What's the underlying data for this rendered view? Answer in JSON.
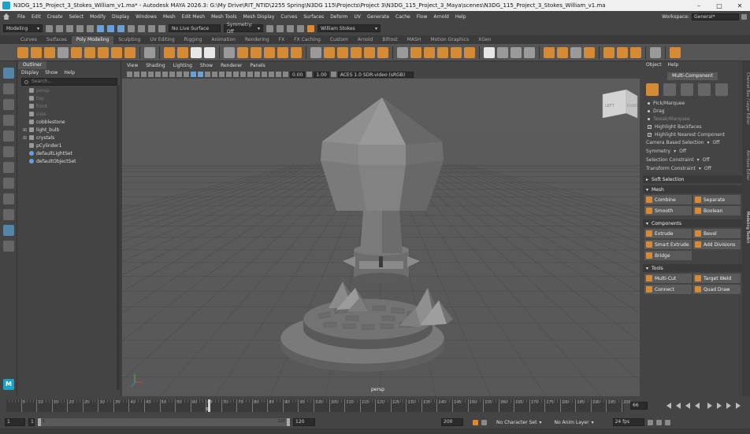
{
  "window": {
    "title": "N3DG_115_Project_3_Stokes_William_v1.ma* - Autodesk MAYA 2026.3: G:\\My Drive\\RIT_NTID\\2255 Spring\\N3DG 115\\Projects\\Project 3\\N3DG_115_Project_3_Maya\\scenes\\N3DG_115_Project_3_Stokes_William_v1.ma",
    "minimize": "–",
    "maximize": "□",
    "close": "✕"
  },
  "menubar": {
    "items": [
      "File",
      "Edit",
      "Create",
      "Select",
      "Modify",
      "Display",
      "Windows",
      "Mesh",
      "Edit Mesh",
      "Mesh Tools",
      "Mesh Display",
      "Curves",
      "Surfaces",
      "Deform",
      "UV",
      "Generate",
      "Cache",
      "Flow",
      "Arnold",
      "Help"
    ],
    "workspace_label": "Workspace:",
    "workspace_value": "General*"
  },
  "statusline": {
    "mode": "Modeling",
    "live_surface": "No Live Surface",
    "symmetry": "Symmetry: Off",
    "user": "William Stokes"
  },
  "shelf": {
    "tabs": [
      "Curves",
      "Surfaces",
      "Poly Modeling",
      "Sculpting",
      "UV Editing",
      "Rigging",
      "Animation",
      "Rendering",
      "FX",
      "FX Caching",
      "Custom",
      "Arnold",
      "Bifrost",
      "MASH",
      "Motion Graphics",
      "XGen"
    ],
    "active_tab": "Poly Modeling"
  },
  "outliner": {
    "tab": "Outliner",
    "menu": [
      "Display",
      "Show",
      "Help"
    ],
    "search_placeholder": "Search...",
    "items": [
      {
        "label": "persp",
        "dim": true,
        "expandable": false
      },
      {
        "label": "top",
        "dim": true,
        "expandable": false
      },
      {
        "label": "front",
        "dim": true,
        "expandable": false
      },
      {
        "label": "side",
        "dim": true,
        "expandable": false
      },
      {
        "label": "cobblestone",
        "dim": false,
        "expandable": false
      },
      {
        "label": "light_bulb",
        "dim": false,
        "expandable": true
      },
      {
        "label": "crystals",
        "dim": false,
        "expandable": true
      },
      {
        "label": "pCylinder1",
        "dim": false,
        "expandable": false
      },
      {
        "label": "defaultLightSet",
        "dim": false,
        "expandable": false
      },
      {
        "label": "defaultObjectSet",
        "dim": false,
        "expandable": false
      }
    ]
  },
  "viewport": {
    "menu": [
      "View",
      "Shading",
      "Lighting",
      "Show",
      "Renderer",
      "Panels"
    ],
    "exposure": "0.00",
    "gamma": "1.00",
    "colorspace": "ACES 1.0 SDR-video (sRGB)",
    "camera_label": "persp",
    "viewcube_left": "LEFT",
    "viewcube_front": "FRONT"
  },
  "modeling_toolkit": {
    "menu": [
      "Object",
      "Help"
    ],
    "mode_button": "Multi-Component",
    "options": [
      {
        "label": "Pick/Marquee",
        "kind": "radio",
        "dim": false
      },
      {
        "label": "Drag",
        "kind": "radio",
        "dim": false
      },
      {
        "label": "Tweak/Marquee",
        "kind": "radio",
        "dim": true
      },
      {
        "label": "Highlight Backfaces",
        "kind": "check",
        "dim": false
      },
      {
        "label": "Highlight Nearest Component",
        "kind": "check",
        "dim": false
      }
    ],
    "camera_selection": "Camera Based Selection",
    "camera_selection_value": "Off",
    "symmetry_label": "Symmetry",
    "symmetry_value": "Off",
    "selection_constraint": "Selection Constraint",
    "selection_constraint_value": "Off",
    "transform_constraint": "Transform Constraint",
    "transform_constraint_value": "Off",
    "soft_selection": "Soft Selection",
    "sections": {
      "mesh": {
        "title": "Mesh",
        "buttons": [
          "Combine",
          "Separate",
          "Smooth",
          "Boolean"
        ]
      },
      "components": {
        "title": "Components",
        "buttons": [
          "Extrude",
          "Bevel",
          "Smart Extrude",
          "Add Divisions",
          "Bridge"
        ]
      },
      "tools": {
        "title": "Tools",
        "buttons": [
          "Multi-Cut",
          "Target Weld",
          "Connect",
          "Quad Draw"
        ]
      }
    },
    "side_tabs": [
      "Channel Box / Layer Editor",
      "Attribute Editor",
      "Modeling Toolkit"
    ]
  },
  "timeline": {
    "start": 1,
    "end": 200,
    "ticks": [
      1,
      5,
      10,
      15,
      20,
      25,
      30,
      35,
      40,
      45,
      50,
      55,
      60,
      65,
      70,
      75,
      80,
      85,
      90,
      95,
      100,
      105,
      110,
      115,
      120,
      125,
      130,
      135,
      140,
      145,
      150,
      155,
      160,
      165,
      170,
      175,
      180,
      185,
      190,
      195,
      200
    ],
    "tick_labels": [
      "5",
      "10",
      "15",
      "20",
      "25",
      "30",
      "35",
      "40",
      "45",
      "50",
      "55",
      "60",
      "65",
      "70",
      "75",
      "80",
      "85",
      "90",
      "95",
      "100",
      "105",
      "110",
      "115",
      "120",
      "125",
      "130",
      "135",
      "140",
      "145",
      "150",
      "155",
      "160",
      "165",
      "170",
      "175",
      "180",
      "185",
      "190",
      "195",
      "200"
    ],
    "current_frame": 66,
    "current_frame_label": "66",
    "frame_box": "66"
  },
  "range": {
    "start": "1",
    "range_start": "1",
    "range_end_inner": "120",
    "range_end": "120",
    "end": "200",
    "character_set": "No Character Set",
    "anim_layer": "No Anim Layer",
    "fps": "24 fps"
  }
}
